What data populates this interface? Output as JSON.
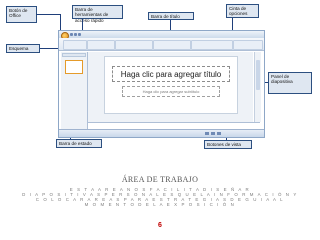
{
  "callouts": {
    "boton_office": "Botón de Office",
    "barra_acceso_rapido": "Barra de herramientas de acceso rápido",
    "barra_titulo": "Barra de título",
    "cinta_opciones": "Cinta de opciones",
    "esquema": "Esquema",
    "panel_diapositivas": "Panel de diapositiva",
    "barra_estado": "Barra de estado",
    "botones_vista": "Botones de vista"
  },
  "slide": {
    "title_placeholder": "Haga clic para agregar título",
    "subtitle_placeholder": "Haga clic para agregar subtítulo"
  },
  "section": {
    "heading": "ÁREA DE TRABAJO",
    "description_lines": [
      "E S T A  A R E A  N O S  F A C I L I T A  D I S E Ñ A R",
      "D I A P O S I T I V A S  P E R S O N A L E S  Q U E  L A  I N F O R M A C I Ó N  Y",
      "C O L O C A R  A R E A S  P A R A  E S T R A T E G I A S  D E  G U I A  A L",
      "M O M E N T O  D E  L A  E X P O S I C I Ó N"
    ]
  },
  "page_number": "6",
  "colors": {
    "callout_bg": "#dfe7f1",
    "callout_border": "#2c4f80",
    "pointer": "#1f3f7a",
    "page_number": "#c00000"
  }
}
